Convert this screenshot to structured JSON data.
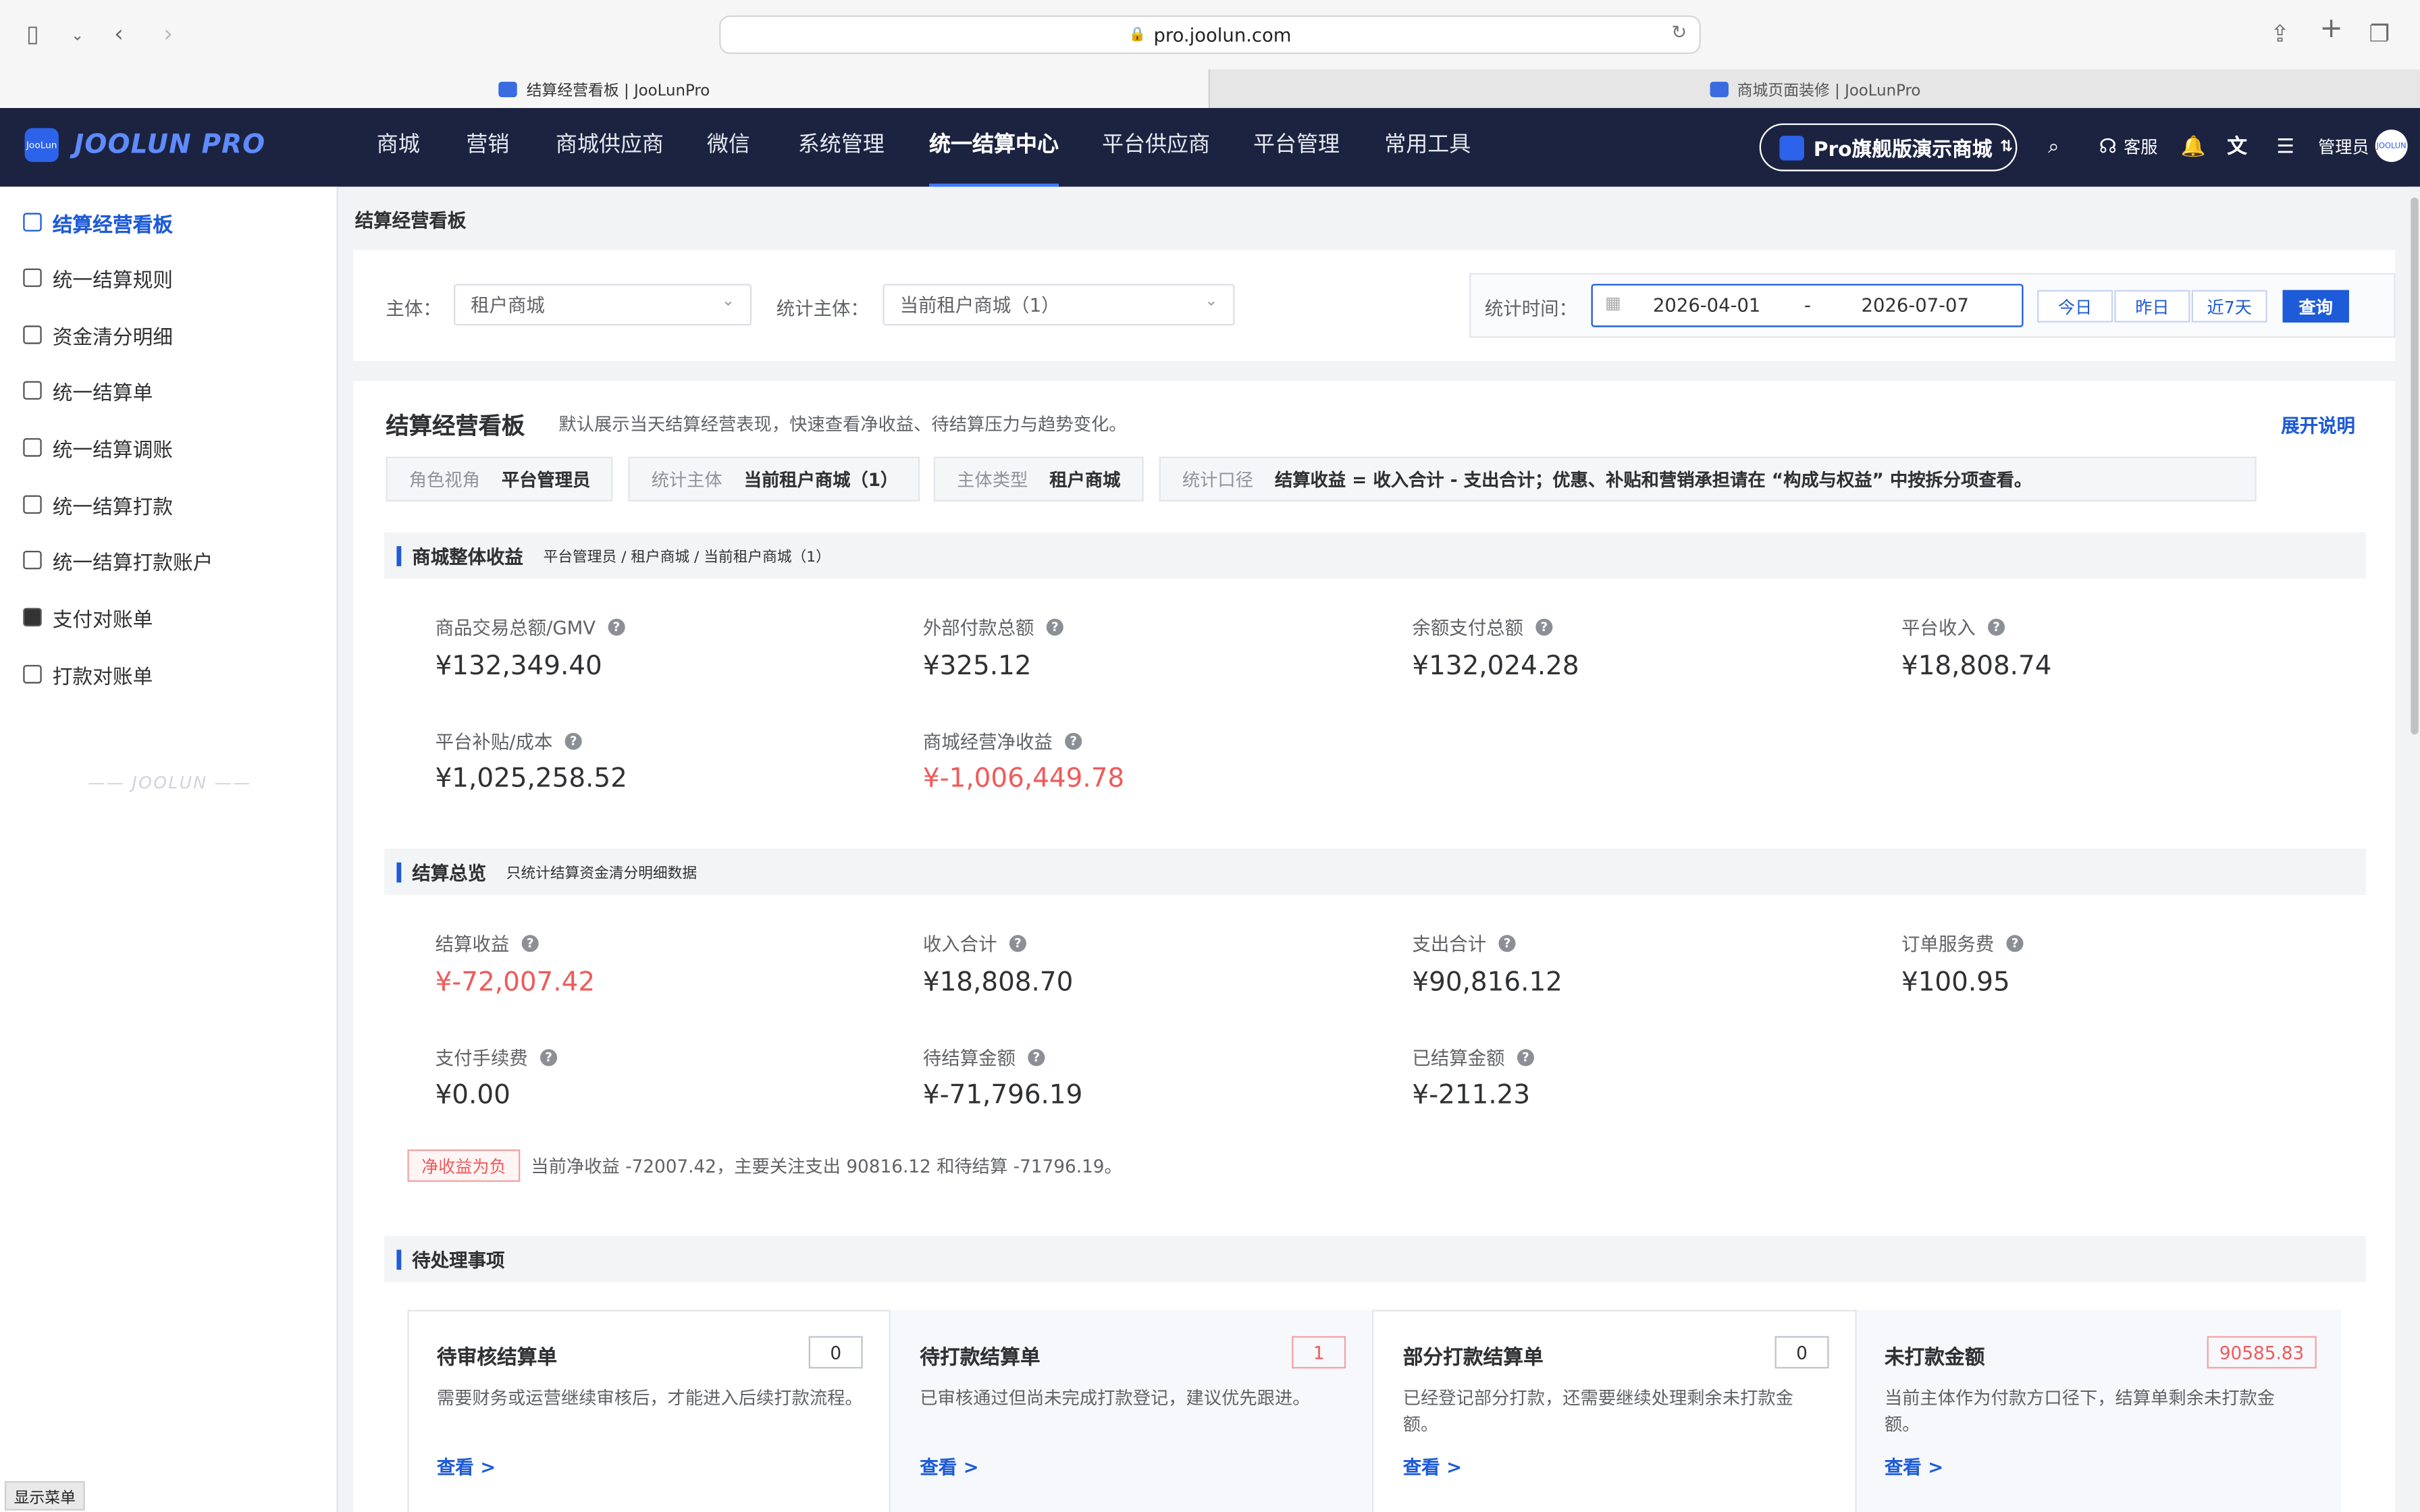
{
  "browser": {
    "url": "pro.joolun.com",
    "tabs": [
      {
        "label": "结算经营看板 | JooLunPro"
      },
      {
        "label": "商城页面装修 | JooLunPro"
      }
    ]
  },
  "header": {
    "logo_small": "JooLun",
    "logo_text": "JOOLUN PRO",
    "nav": [
      "商城",
      "营销",
      "商城供应商",
      "微信",
      "系统管理",
      "统一结算中心",
      "平台供应商",
      "平台管理",
      "常用工具"
    ],
    "active_nav": "统一结算中心",
    "shop_button": "Pro旗舰版演示商城",
    "service_label": "客服",
    "user_label": "管理员",
    "avatar_text": "JOOLUN"
  },
  "sidebar": {
    "items": [
      {
        "label": "结算经营看板"
      },
      {
        "label": "统一结算规则"
      },
      {
        "label": "资金清分明细"
      },
      {
        "label": "统一结算单"
      },
      {
        "label": "统一结算调账"
      },
      {
        "label": "统一结算打款"
      },
      {
        "label": "统一结算打款账户"
      },
      {
        "label": "支付对账单"
      },
      {
        "label": "打款对账单"
      }
    ],
    "watermark": "JOOLUN",
    "toggle_label": "显示菜单"
  },
  "page": {
    "title": "结算经营看板"
  },
  "filters": {
    "subject_label": "主体：",
    "subject_value": "租户商城",
    "stat_subject_label": "统计主体：",
    "stat_subject_value": "当前租户商城（1）",
    "time_label": "统计时间：",
    "date_start": "2026-04-01",
    "date_sep": "-",
    "date_end": "2026-07-07",
    "quick": [
      "今日",
      "昨日",
      "近7天"
    ],
    "query": "查询"
  },
  "board": {
    "title": "结算经营看板",
    "subtitle": "默认展示当天结算经营表现，快速查看净收益、待结算压力与趋势变化。",
    "expand": "展开说明",
    "chips": [
      {
        "k": "角色视角",
        "v": "平台管理员"
      },
      {
        "k": "统计主体",
        "v": "当前租户商城（1）"
      },
      {
        "k": "主体类型",
        "v": "租户商城"
      },
      {
        "k": "统计口径",
        "v": "结算收益 = 收入合计 - 支出合计；优惠、补贴和营销承担请在 “构成与权益” 中按拆分项查看。"
      }
    ]
  },
  "section1": {
    "title": "商城整体收益",
    "sub": "平台管理员 / 租户商城 / 当前租户商城（1）",
    "metrics": [
      {
        "label": "商品交易总额/GMV",
        "value": "¥132,349.40"
      },
      {
        "label": "外部付款总额",
        "value": "¥325.12"
      },
      {
        "label": "余额支付总额",
        "value": "¥132,024.28"
      },
      {
        "label": "平台收入",
        "value": "¥18,808.74"
      },
      {
        "label": "平台补贴/成本",
        "value": "¥1,025,258.52"
      },
      {
        "label": "商城经营净收益",
        "value": "¥-1,006,449.78"
      }
    ]
  },
  "section2": {
    "title": "结算总览",
    "sub": "只统计结算资金清分明细数据",
    "metrics": [
      {
        "label": "结算收益",
        "value": "¥-72,007.42"
      },
      {
        "label": "收入合计",
        "value": "¥18,808.70"
      },
      {
        "label": "支出合计",
        "value": "¥90,816.12"
      },
      {
        "label": "订单服务费",
        "value": "¥100.95"
      },
      {
        "label": "支付手续费",
        "value": "¥0.00"
      },
      {
        "label": "待结算金额",
        "value": "¥-71,796.19"
      },
      {
        "label": "已结算金额",
        "value": "¥-211.23"
      }
    ],
    "badge": "净收益为负",
    "note": "当前净收益 -72007.42，主要关注支出 90816.12 和待结算 -71796.19。"
  },
  "section3": {
    "title": "待处理事项",
    "todos": [
      {
        "title": "待审核结算单",
        "count": "0",
        "desc": "需要财务或运营继续审核后，才能进入后续打款流程。",
        "link": "查看 >"
      },
      {
        "title": "待打款结算单",
        "count": "1",
        "desc": "已审核通过但尚未完成打款登记，建议优先跟进。",
        "link": "查看 >"
      },
      {
        "title": "部分打款结算单",
        "count": "0",
        "desc": "已经登记部分打款，还需要继续处理剩余未打款金额。",
        "link": "查看 >"
      },
      {
        "title": "未打款金额",
        "count": "90585.83",
        "desc": "当前主体作为付款方口径下，结算单剩余未打款金额。",
        "link": "查看 >"
      }
    ]
  },
  "colors": {
    "accent": "#1e5bd8",
    "header_bg": "#1c2340",
    "negative": "#f05a5a"
  }
}
